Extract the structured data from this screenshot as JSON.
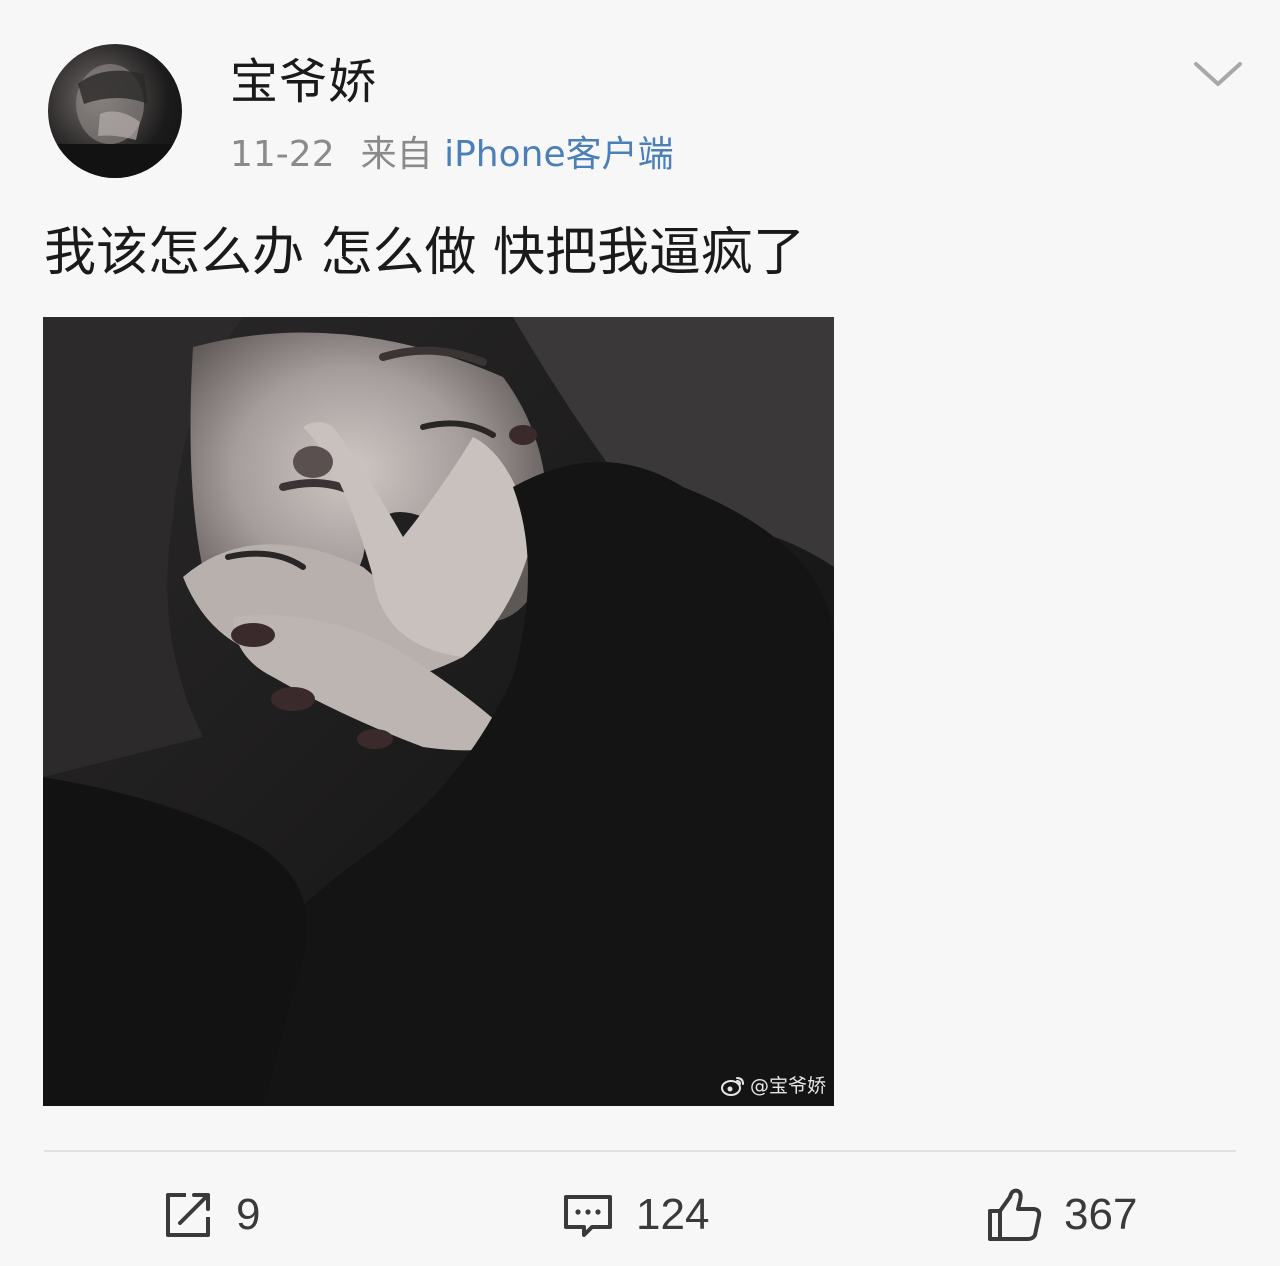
{
  "post": {
    "author": "宝爷娇",
    "date": "11-22",
    "source_prefix": "来自",
    "source_client": "iPhone客户端",
    "text": "我该怎么办 怎么做 快把我逼疯了",
    "image_watermark": "@宝爷娇"
  },
  "actions": {
    "repost_count": "9",
    "comment_count": "124",
    "like_count": "367"
  },
  "icons": {
    "more": "chevron-down-icon",
    "repost": "share-edit-icon",
    "comment": "comment-bubble-icon",
    "like": "thumbs-up-icon",
    "watermark_logo": "weibo-logo-icon"
  },
  "colors": {
    "background": "#f7f7f7",
    "link": "#4b7fb8",
    "meta": "#8a8a8a",
    "text": "#1a1a1a"
  }
}
